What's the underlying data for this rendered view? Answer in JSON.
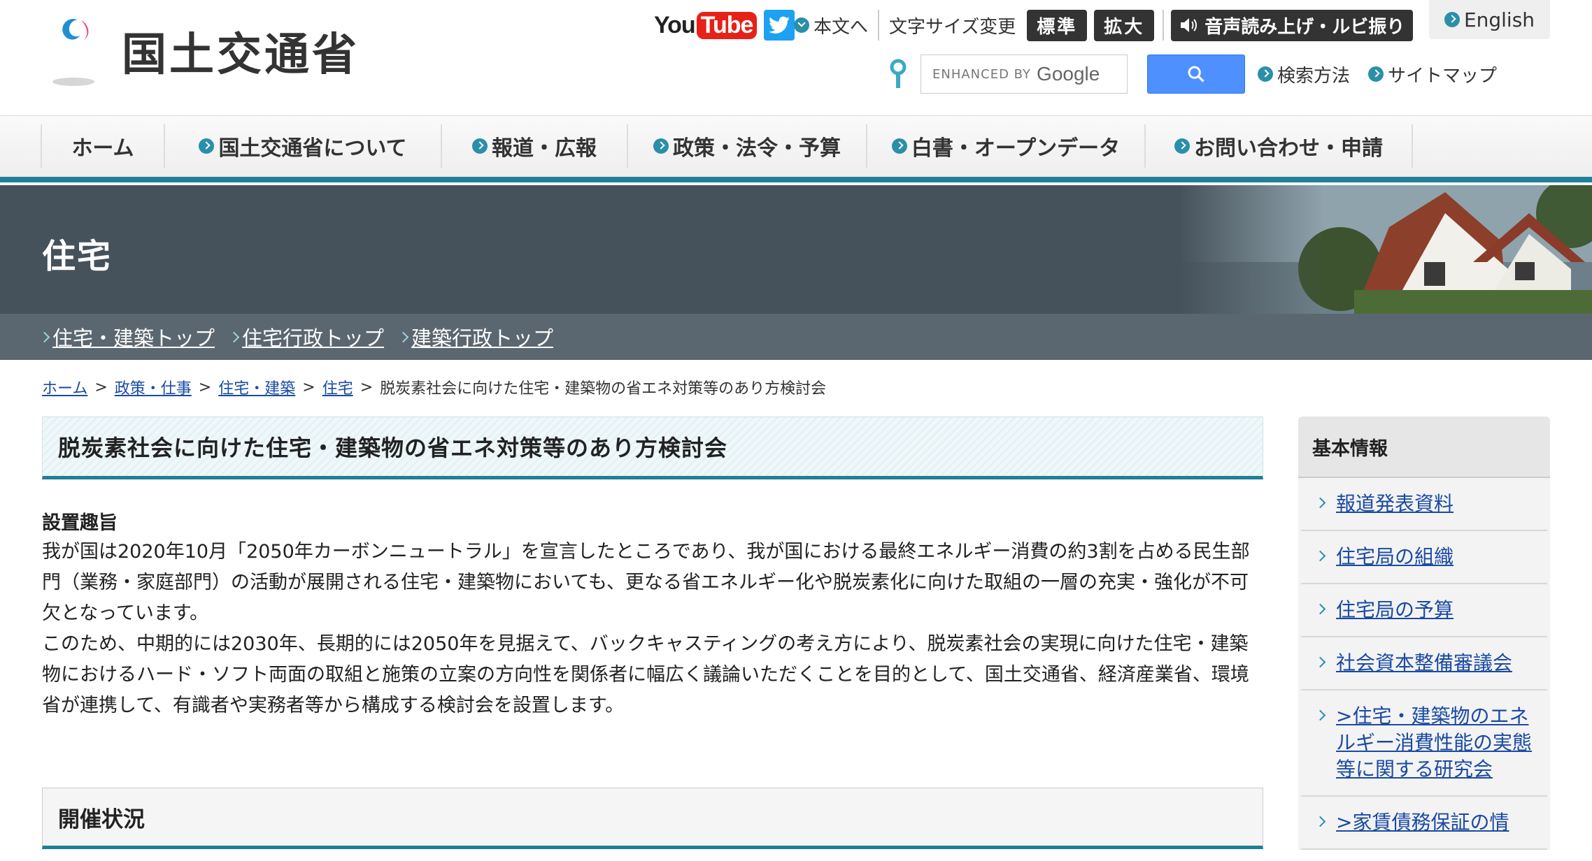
{
  "header": {
    "logo_text": "国土交通省",
    "youtube_label_you": "You",
    "youtube_label_tube": "Tube",
    "skip_to_content": "本文へ",
    "font_size_label": "文字サイズ変更",
    "font_standard": "標準",
    "font_large": "拡大",
    "voice_label": "音声読み上げ・ルビ振り",
    "english_label": "English",
    "search_placeholder_prefix": "ENHANCED BY",
    "search_placeholder_brand": "Google",
    "search_method_label": "検索方法",
    "sitemap_label": "サイトマップ"
  },
  "gnav": {
    "items": [
      {
        "label": "ホーム"
      },
      {
        "label": "国土交通省について"
      },
      {
        "label": "報道・広報"
      },
      {
        "label": "政策・法令・予算"
      },
      {
        "label": "白書・オープンデータ"
      },
      {
        "label": "お問い合わせ・申請"
      }
    ]
  },
  "banner": {
    "title": "住宅",
    "links": [
      "住宅・建築トップ",
      "住宅行政トップ",
      "建築行政トップ"
    ]
  },
  "breadcrumb": {
    "items": [
      "ホーム",
      "政策・仕事",
      "住宅・建築",
      "住宅"
    ],
    "current": "脱炭素社会に向けた住宅・建築物の省エネ対策等のあり方検討会",
    "separator": ">"
  },
  "main": {
    "title": "脱炭素社会に向けた住宅・建築物の省エネ対策等のあり方検討会",
    "section_label": "設置趣旨",
    "paragraph1": "我が国は2020年10月「2050年カーボンニュートラル」を宣言したところであり、我が国における最終エネルギー消費の約3割を占める民生部門（業務・家庭部門）の活動が展開される住宅・建築物においても、更なる省エネルギー化や脱炭素化に向けた取組の一層の充実・強化が不可欠となっています。",
    "paragraph2": "このため、中期的には2030年、長期的には2050年を見据えて、バックキャスティングの考え方により、脱炭素社会の実現に向けた住宅・建築物におけるハード・ソフト両面の取組と施策の立案の方向性を関係者に幅広く議論いただくことを目的として、国土交通省、経済産業省、環境省が連携して、有識者や実務者等から構成する検討会を設置します。",
    "section2_title": "開催状況"
  },
  "sidebar": {
    "title": "基本情報",
    "items": [
      {
        "label": "報道発表資料"
      },
      {
        "label": "住宅局の組織"
      },
      {
        "label": "住宅局の予算"
      },
      {
        "label": "社会資本整備審議会"
      },
      {
        "label": ">住宅・建築物のエネルギー消費性能の実態等に関する研究会"
      },
      {
        "label": ">家賃債務保証の情"
      }
    ]
  },
  "colors": {
    "accent": "#1f7f99",
    "banner_bg": "#46525b",
    "subnav_bg": "#5b6770",
    "link": "#1a4aa3"
  }
}
